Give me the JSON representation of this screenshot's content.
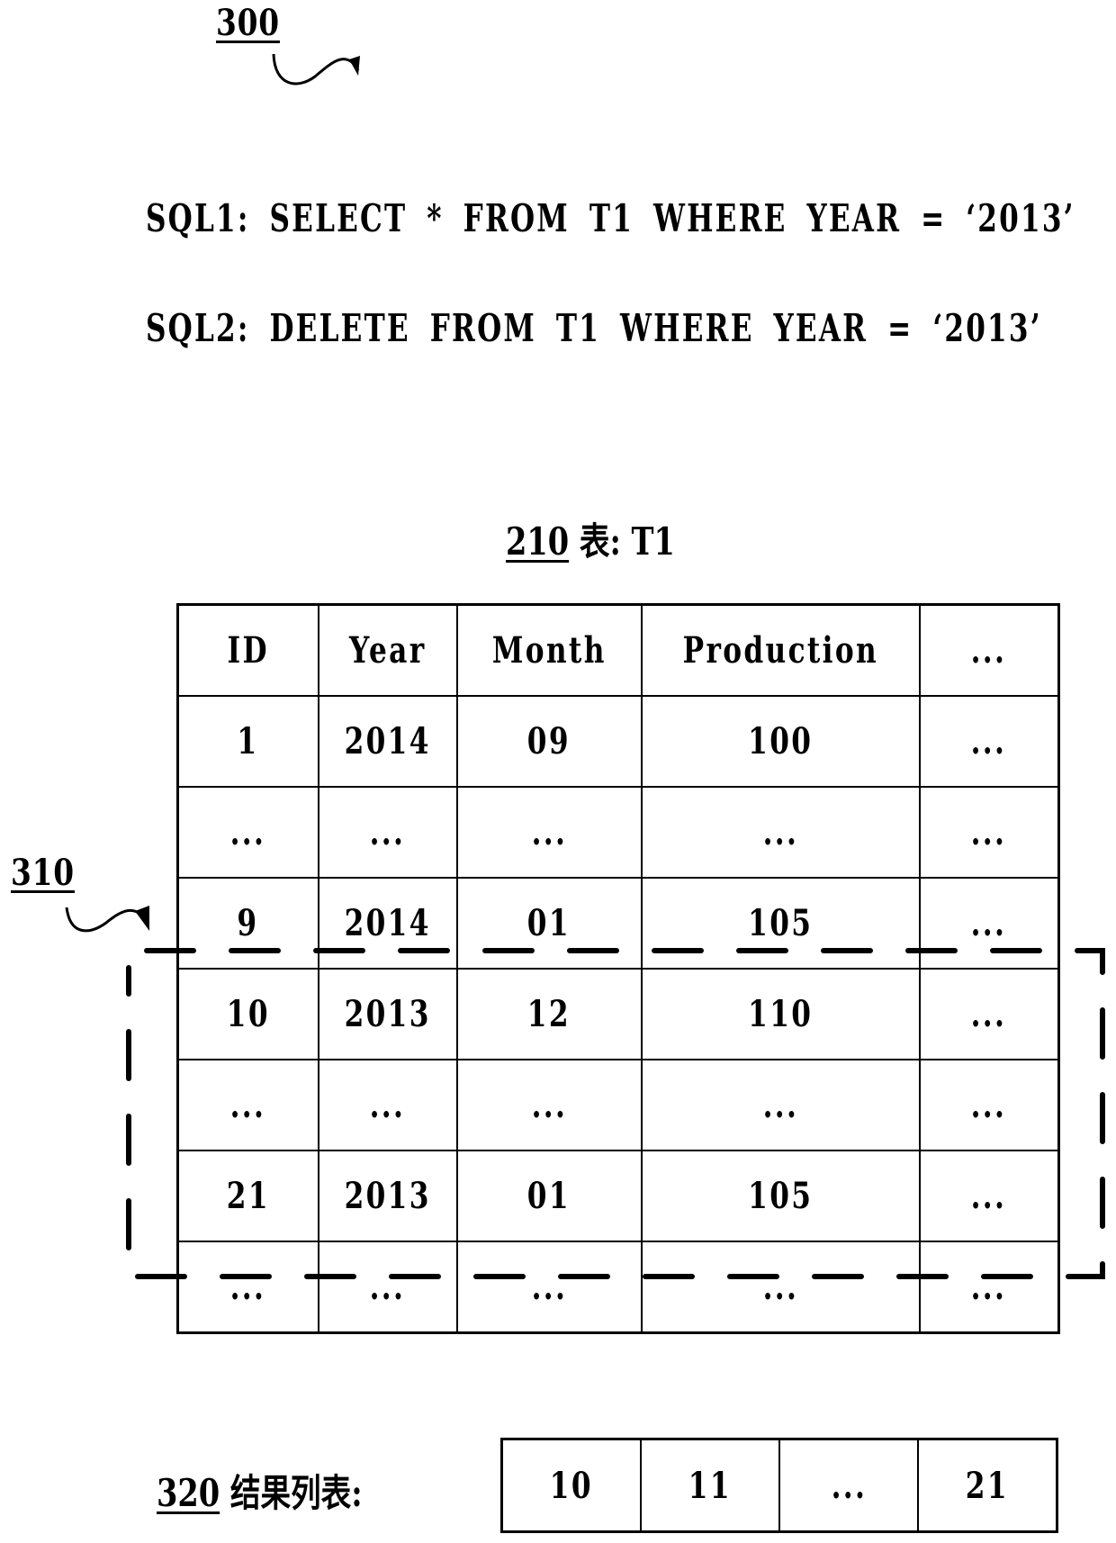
{
  "figure": {
    "ref_label": "300"
  },
  "queries": [
    {
      "label": "SQL1:",
      "text": "SELECT * FROM T1 WHERE YEAR = ‘2013’"
    },
    {
      "label": "SQL2:",
      "text": "DELETE FROM T1 WHERE YEAR = ‘2013’"
    }
  ],
  "table": {
    "ref_label": "210",
    "title": "表: T1",
    "columns": [
      "ID",
      "Year",
      "Month",
      "Production",
      "..."
    ],
    "rows": [
      [
        "1",
        "2014",
        "09",
        "100",
        "..."
      ],
      [
        "...",
        "...",
        "...",
        "...",
        "..."
      ],
      [
        "9",
        "2014",
        "01",
        "105",
        "..."
      ],
      [
        "10",
        "2013",
        "12",
        "110",
        "..."
      ],
      [
        "...",
        "...",
        "...",
        "...",
        "..."
      ],
      [
        "21",
        "2013",
        "01",
        "105",
        "..."
      ],
      [
        "...",
        "...",
        "...",
        "...",
        "..."
      ]
    ]
  },
  "selection": {
    "ref_label": "310",
    "style": "dashed",
    "covers_rows": [
      "10",
      "...",
      "21"
    ]
  },
  "result_list": {
    "ref_label": "320",
    "title": "结果列表:",
    "items": [
      "10",
      "11",
      "...",
      "21"
    ]
  }
}
